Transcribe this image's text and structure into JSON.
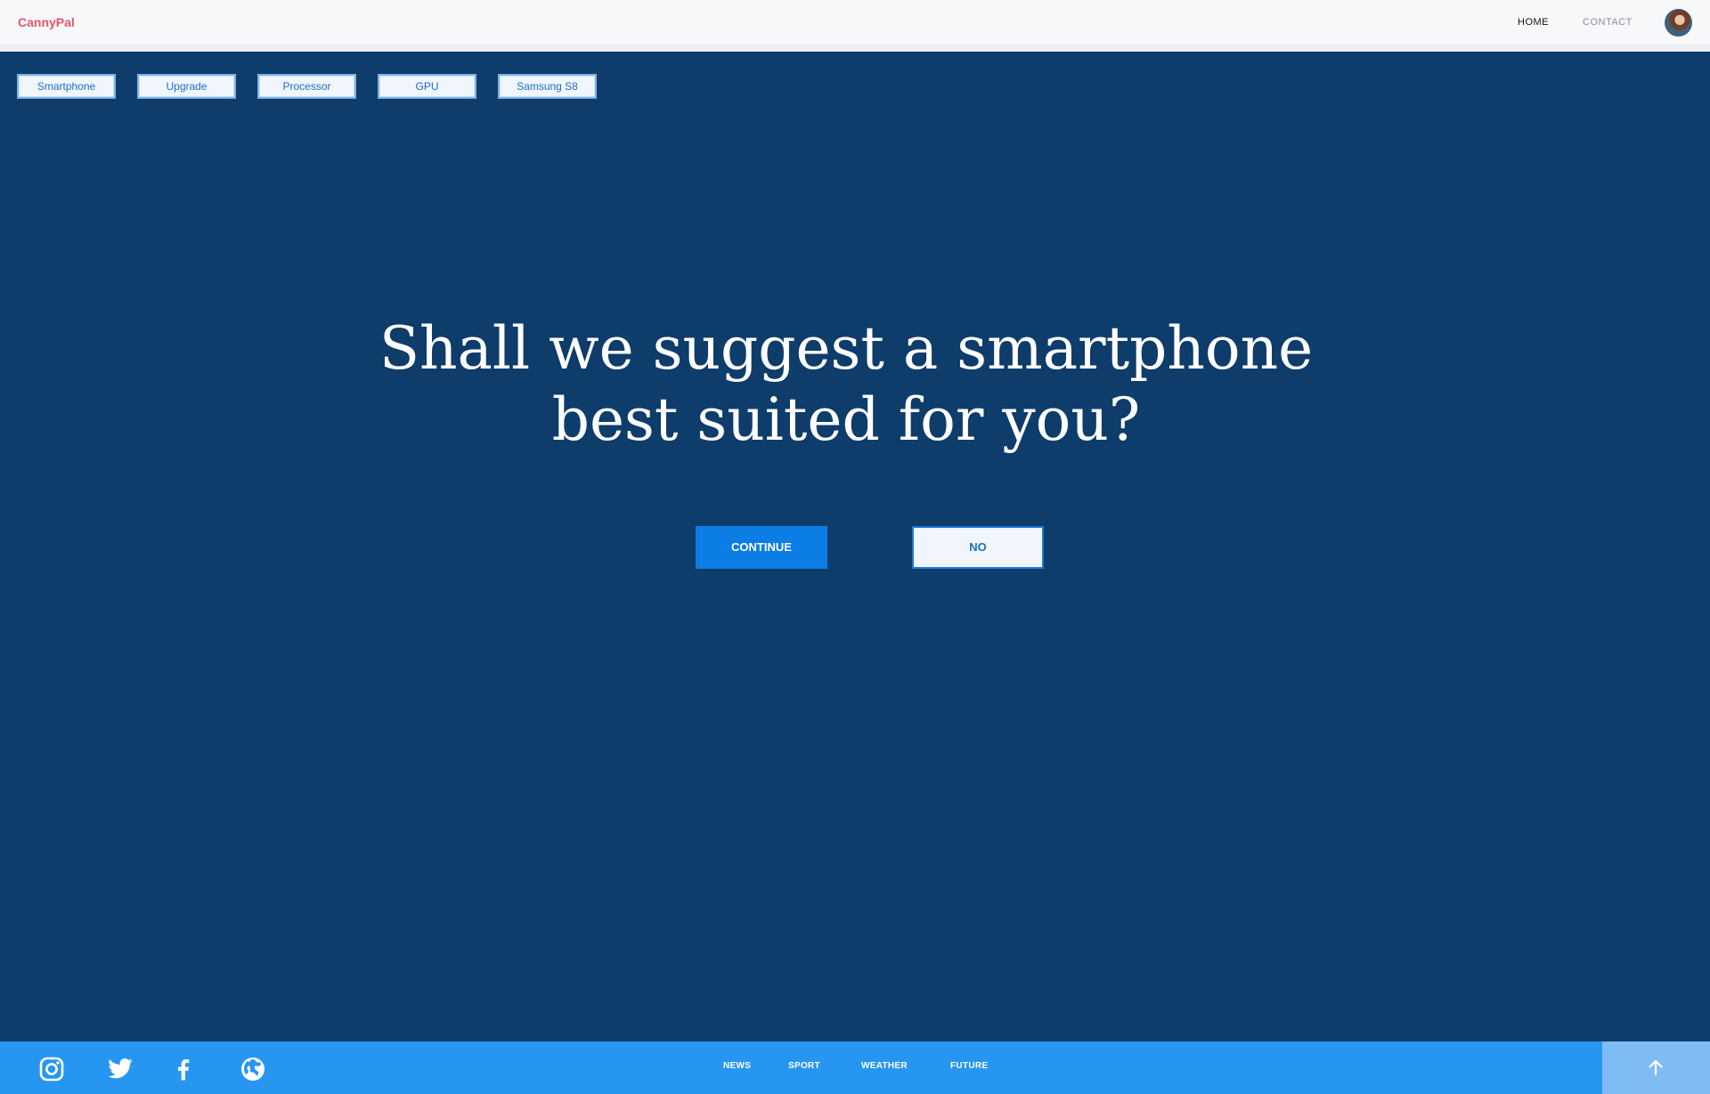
{
  "header": {
    "brand": "CannyPal",
    "nav": {
      "home": "HOME",
      "contact": "CONTACT"
    }
  },
  "tags": [
    "Smartphone",
    "Upgrade",
    "Processor",
    "GPU",
    "Samsung S8"
  ],
  "hero": {
    "title_line1": "Shall we suggest a smartphone",
    "title_line2": "best suited for you?",
    "continue_label": "CONTINUE",
    "no_label": "NO"
  },
  "footer": {
    "social_icons": [
      "instagram-icon",
      "twitter-icon",
      "facebook-icon",
      "globe-icon"
    ],
    "links": [
      "NEWS",
      "SPORT",
      "WEATHER",
      "FUTURE"
    ],
    "scroll_top_icon": "arrow-up-icon"
  },
  "colors": {
    "page_bg": "#0e3c6b",
    "brand": "#e4566c",
    "primary_button": "#0d7de6",
    "footer_bg": "#2796f1",
    "scroll_top_bg": "#7fbcf4"
  }
}
